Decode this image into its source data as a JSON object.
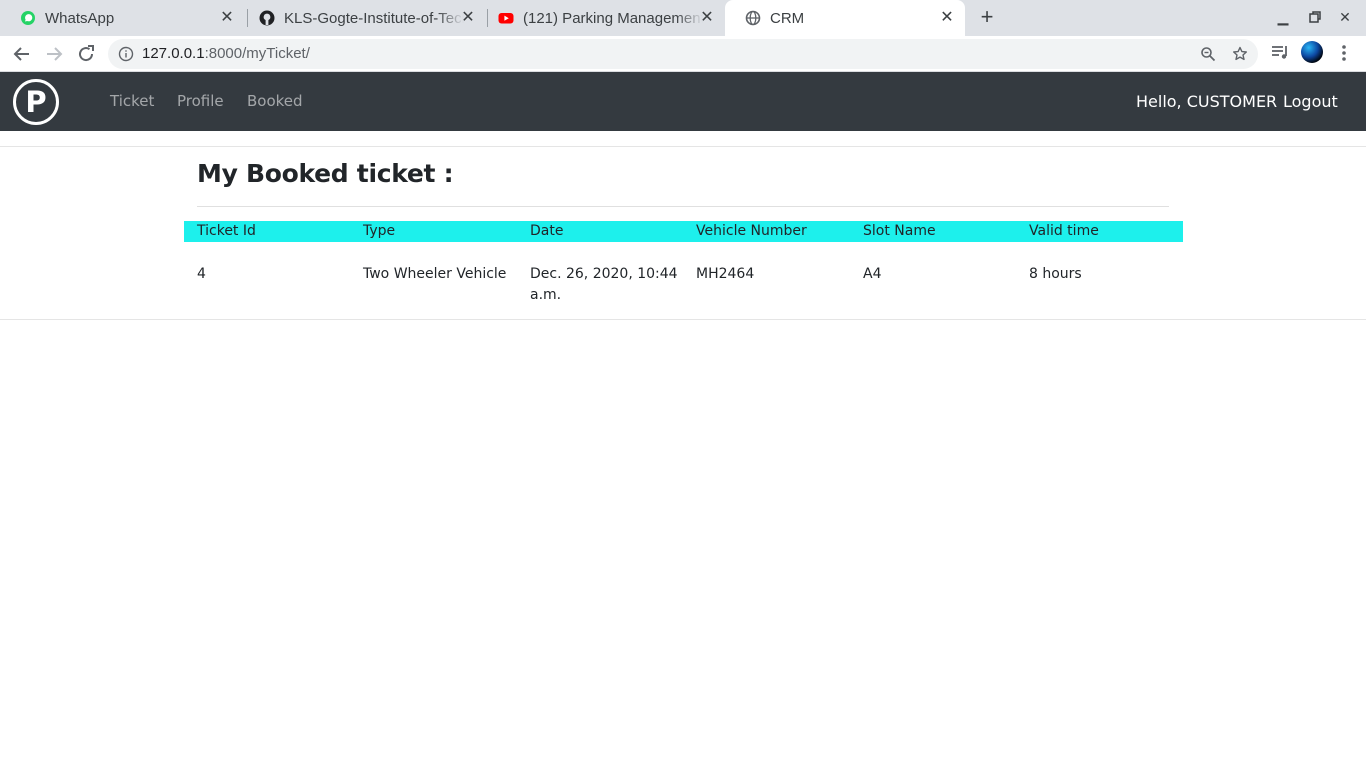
{
  "browser": {
    "tabs": [
      {
        "title": "WhatsApp",
        "icon": "whatsapp-icon"
      },
      {
        "title": "KLS-Gogte-Institute-of-Technology",
        "icon": "github-icon"
      },
      {
        "title": "(121) Parking Management",
        "icon": "youtube-icon"
      },
      {
        "title": "CRM",
        "icon": "globe-icon"
      }
    ],
    "url_host": "127.0.0.1",
    "url_path": ":8000/myTicket/"
  },
  "navbar": {
    "brand_letter": "P",
    "links": [
      "Ticket",
      "Profile",
      "Booked"
    ],
    "greeting": "Hello, CUSTOMER",
    "logout": "Logout"
  },
  "page": {
    "title": "My Booked ticket :"
  },
  "table": {
    "header_color": "#1df0ec",
    "headers": [
      "Ticket Id",
      "Type",
      "Date",
      "Vehicle Number",
      "Slot Name",
      "Valid time"
    ],
    "rows": [
      {
        "ticket_id": "4",
        "type": "Two Wheeler Vehicle",
        "date_line1": "Dec. 26, 2020, 10:44",
        "date_line2": "a.m.",
        "vehicle_number": "MH2464",
        "slot_name": "A4",
        "valid_time": "8 hours"
      }
    ]
  }
}
